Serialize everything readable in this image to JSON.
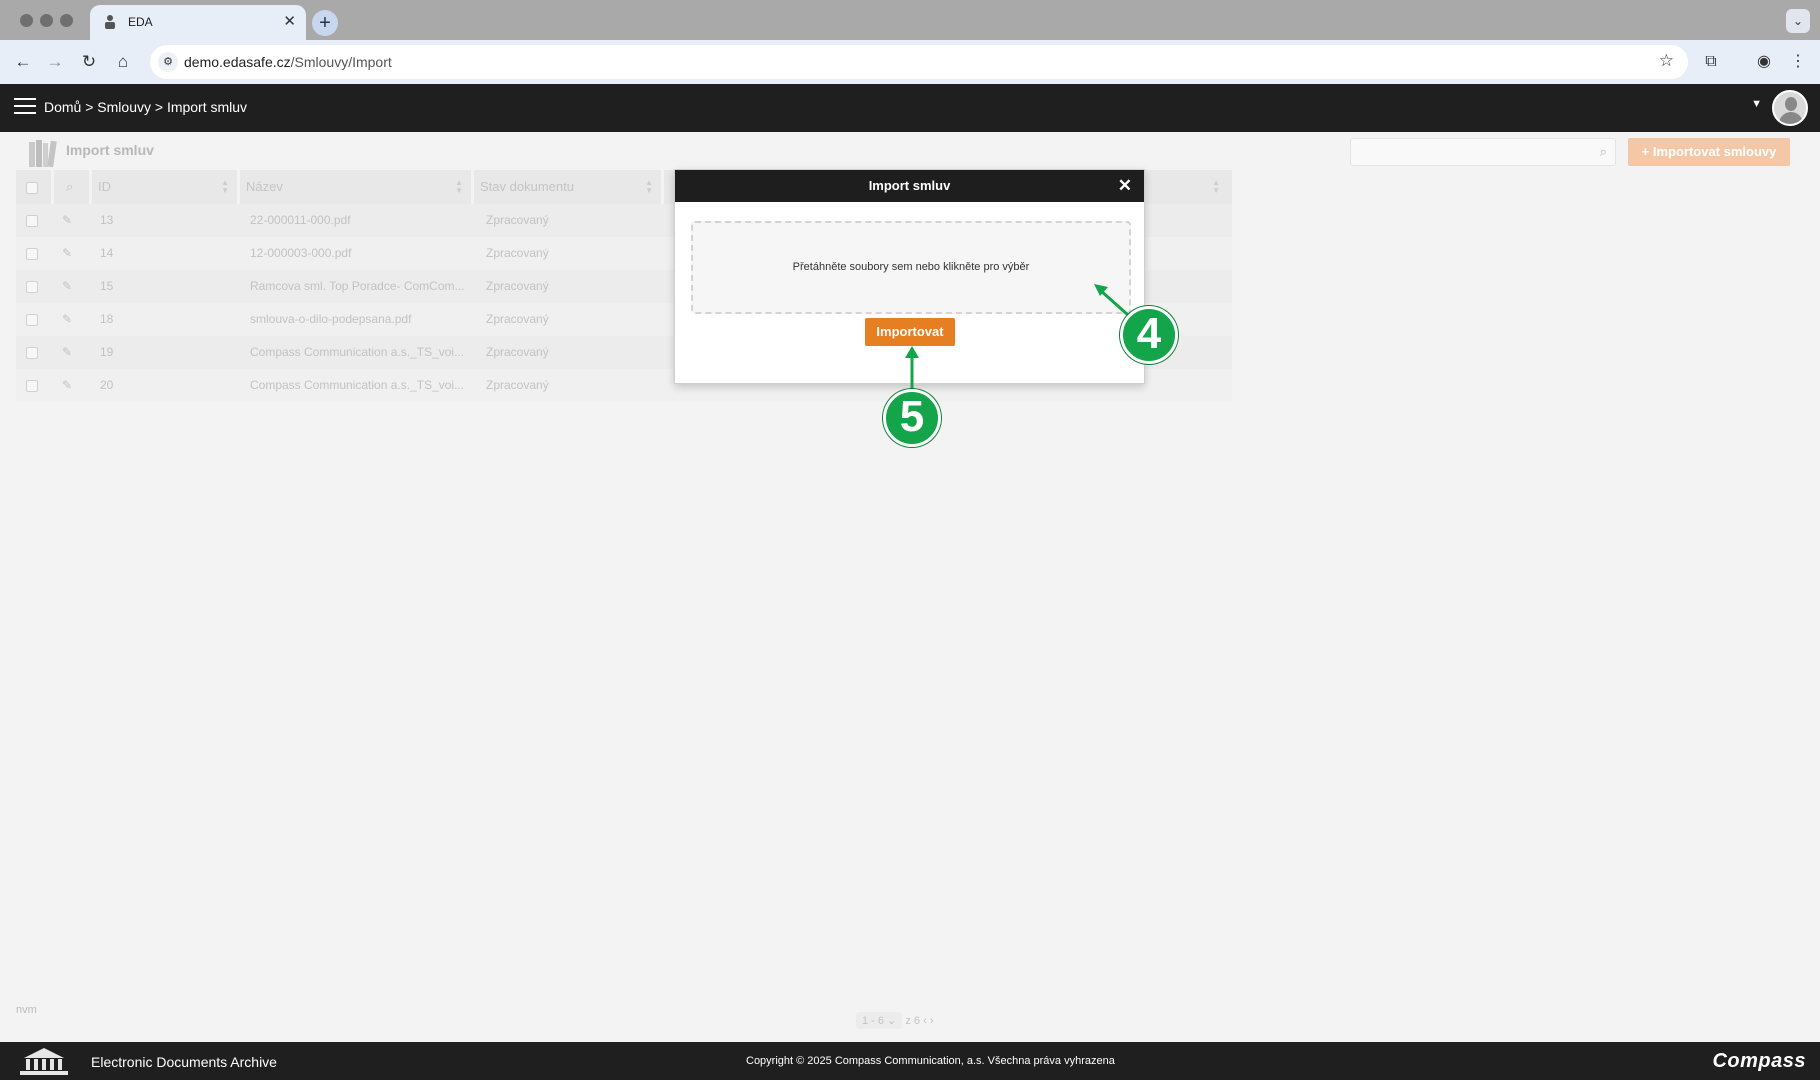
{
  "browser": {
    "tab_title": "EDA",
    "url_domain": "demo.edasafe.cz",
    "url_path": "/Smlouvy/Import"
  },
  "header": {
    "breadcrumb": "Domů > Smlouvy > Import smluv"
  },
  "page": {
    "title": "Import smluv",
    "import_button_label": "+ Importovat smlouvy"
  },
  "table": {
    "columns": [
      "ID",
      "Název",
      "Stav dokumentu"
    ],
    "rows": [
      {
        "id": "13",
        "name": "22-000011-000.pdf",
        "status": "Zpracovaný"
      },
      {
        "id": "14",
        "name": "12-000003-000.pdf",
        "status": "Zpracovaný"
      },
      {
        "id": "15",
        "name": "Ramcova sml. Top Poradce- ComCom...",
        "status": "Zpracovaný"
      },
      {
        "id": "18",
        "name": "smlouva-o-dilo-podepsana.pdf",
        "status": "Zpracovaný"
      },
      {
        "id": "19",
        "name": "Compass Communication a.s._TS_voi...",
        "status": "Zpracovaný"
      },
      {
        "id": "20",
        "name": "Compass Communication a.s._TS_voi...",
        "status": "Zpracovaný"
      }
    ]
  },
  "footer_left_note": "nvm",
  "pager": {
    "range": "1 - 6",
    "of_total": "z 6"
  },
  "footer": {
    "app_name": "Electronic Documents Archive",
    "copyright": "Copyright © 2025 Compass Communication, a.s. Všechna práva vyhrazena",
    "brand": "Compass"
  },
  "modal": {
    "title": "Import smluv",
    "close_glyph": "✕",
    "dropzone_text": "Přetáhněte soubory sem nebo klikněte pro výběr",
    "import_button": "Importovat"
  },
  "callouts": {
    "step4": "4",
    "step5": "5"
  },
  "colors": {
    "accent_orange": "#e67e22",
    "callout_green": "#14a44a",
    "header_dark": "#1f1f1f"
  }
}
